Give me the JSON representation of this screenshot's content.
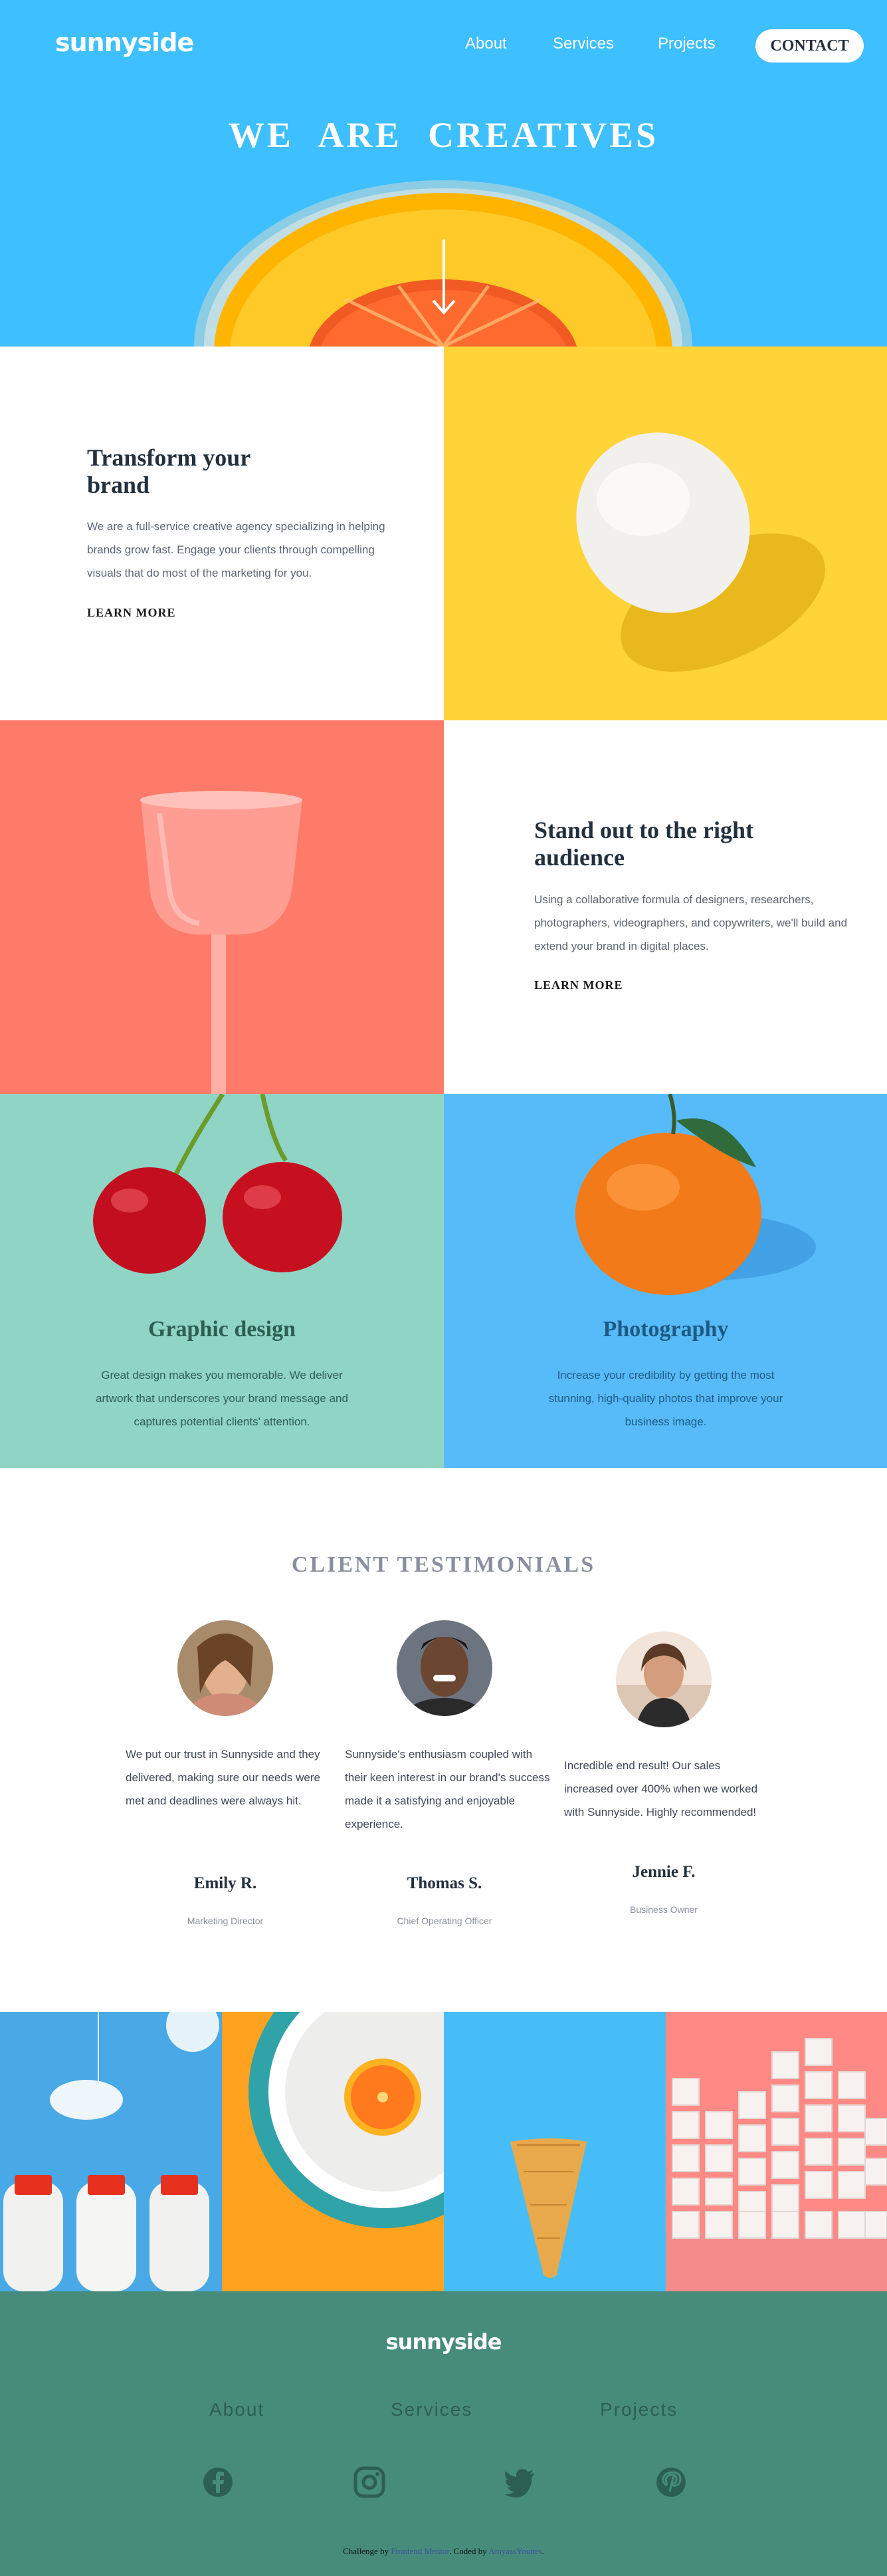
{
  "header": {
    "logo": "sunnyside",
    "nav": [
      {
        "label": "About"
      },
      {
        "label": "Services"
      },
      {
        "label": "Projects"
      }
    ],
    "contact_label": "CONTACT",
    "hero_title": "WE ARE CREATIVES"
  },
  "features": [
    {
      "title": "Transform your brand",
      "body": "We are a full-service creative agency specializing in helping brands grow fast. Engage your clients through compelling visuals that do most of the marketing for you.",
      "link": "LEARN MORE"
    },
    {
      "title": "Stand out to the right audience",
      "body": "Using a collaborative formula of designers, researchers, photographers, videographers, and copywriters, we'll build and extend your brand in digital places.",
      "link": "LEARN MORE"
    }
  ],
  "services": [
    {
      "title": "Graphic design",
      "body": "Great design makes you memorable. We deliver artwork that underscores your brand message and captures potential clients' attention."
    },
    {
      "title": "Photography",
      "body": "Increase your credibility by getting the most stunning, high-quality photos that improve your business image."
    }
  ],
  "testimonials": {
    "heading": "CLIENT TESTIMONIALS",
    "items": [
      {
        "quote": "We put our trust in Sunnyside and they delivered, making sure our needs were met and deadlines were always hit.",
        "name": "Emily R.",
        "role": "Marketing Director"
      },
      {
        "quote": "Sunnyside's enthusiasm coupled with their keen interest in our brand's success made it a satisfying and enjoyable experience.",
        "name": "Thomas S.",
        "role": "Chief Operating Officer"
      },
      {
        "quote": "Incredible end result! Our sales increased over 400% when we worked with Sunnyside. Highly recommended!",
        "name": "Jennie F.",
        "role": "Business Owner"
      }
    ]
  },
  "footer": {
    "logo": "sunnyside",
    "links": [
      {
        "label": "About"
      },
      {
        "label": "Services"
      },
      {
        "label": "Projects"
      }
    ],
    "social_icons": [
      "facebook-icon",
      "instagram-icon",
      "twitter-icon",
      "pinterest-icon"
    ],
    "attribution": {
      "prefix": "Challenge by",
      "challenge_link": "Frontend Mentor",
      "middle": ". Coded by",
      "author_link": "AmyassYounes",
      "suffix": "."
    }
  },
  "colors": {
    "hero_blue": "#3ebfff",
    "egg_yellow": "#fed439",
    "glass_red": "#ff7b69",
    "cherry_teal": "#90d4c5",
    "orange_blue": "#58bbf9",
    "footer_green": "#478c7b"
  }
}
